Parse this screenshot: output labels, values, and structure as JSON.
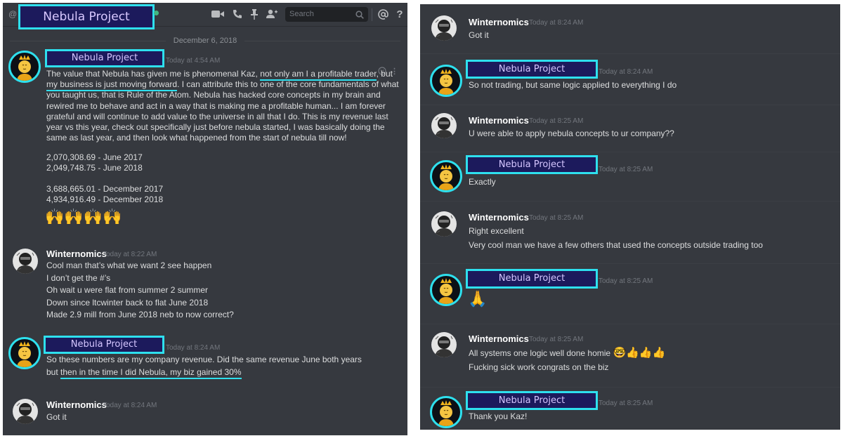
{
  "header": {
    "channel_title": "Nebula Project",
    "search_placeholder": "Search",
    "at_glyph": "@",
    "icons": [
      "video-icon",
      "phone-icon",
      "pin-icon",
      "add-member-icon",
      "search-icon",
      "mention-icon",
      "help-icon"
    ]
  },
  "date_separator": "December 6, 2018",
  "left_messages": [
    {
      "author": "Nebula Project",
      "time": "Today at 4:54 AM",
      "para_a": "The value that Nebula has given me is phenomenal Kaz, ",
      "para_u1": "not only am I a profitable trader",
      "para_b": ", but ",
      "para_u2": "my business is just moving forward",
      "para_c": ". I can attribute this to one of the core fundamentals of what you taught us, that is Rule of the Atom. Nebula has hacked core concepts in my brain and rewired me to behave and act in a way that is making me a profitable human... I am forever grateful and will continue to add value to the universe in all that I do. This is my revenue last year vs this year, check out specifically just before nebula started, I was basically doing the same as last year, and then look what happened from the start of nebula till now!",
      "lines": [
        "2,070,308.69 - June 2017",
        "2,049,748.75 - June 2018",
        "3,688,665.01 - December 2017",
        "4,934,916.49 - December 2018"
      ],
      "emojis": "🙌🙌🙌🙌"
    },
    {
      "author": "Winternomics",
      "time": "Today at 8:22 AM",
      "lines": [
        "Cool man that’s what we want 2 see happen",
        "I don’t get the #’s",
        "Oh wait u were flat from summer 2 summer",
        "Down since ltcwinter back to flat June 2018",
        "Made 2.9 mill from June 2018 neb to now correct?"
      ]
    },
    {
      "author": "Nebula Project",
      "time": "Today at 8:24 AM",
      "line1": "So these numbers are my company revenue. Did the same revenue June both years",
      "line2_a": "but ",
      "line2_u": "then in the time I did Nebula, my biz gained 30%"
    },
    {
      "author": "Winternomics",
      "time": "Today at 8:24 AM",
      "lines": [
        "Got it"
      ]
    }
  ],
  "right_messages": [
    {
      "author": "Winternomics",
      "time": "Today at 8:24 AM",
      "lines": [
        "Got it"
      ]
    },
    {
      "author": "Nebula Project",
      "time": "Today at 8:24 AM",
      "lines": [
        "So not trading, but same logic applied to everything I do"
      ]
    },
    {
      "author": "Winternomics",
      "time": "Today at 8:25 AM",
      "lines": [
        "U were able to apply nebula concepts to ur company??"
      ]
    },
    {
      "author": "Nebula Project",
      "time": "Today at 8:25 AM",
      "lines": [
        "Exactly"
      ]
    },
    {
      "author": "Winternomics",
      "time": "Today at 8:25 AM",
      "lines": [
        "Right excellent",
        "Very cool man we have a few others that used the concepts outside trading too"
      ]
    },
    {
      "author": "Nebula Project",
      "time": "Today at 8:25 AM",
      "lines": [
        "🙏"
      ]
    },
    {
      "author": "Winternomics",
      "time": "Today at 8:25 AM",
      "lines": [
        "All systems one logic well done homie",
        "Fucking sick work congrats on the biz"
      ],
      "emojis": "🤓👍👍👍"
    },
    {
      "author": "Nebula Project",
      "time": "Today at 8:25 AM",
      "lines": [
        "Thank you Kaz!"
      ]
    }
  ],
  "colors": {
    "accent": "#2ee0ee",
    "label_bg": "#1c1a5c",
    "label_text": "#d5c6ff",
    "chat_bg": "#36393f"
  }
}
